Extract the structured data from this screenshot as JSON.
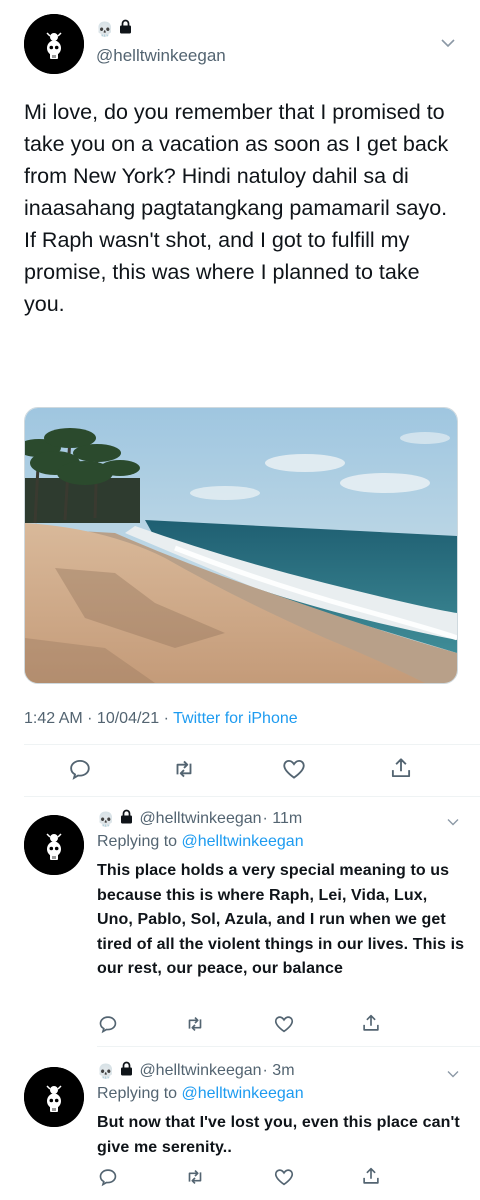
{
  "main_tweet": {
    "handle": "@helltwinkeegan",
    "text": "Mi love, do you remember that I promised to take you on a vacation as soon as I get back from New York? Hindi natuloy dahil sa di inaasahang pagtatangkang pamamaril sayo. If Raph wasn't shot, and I got to fulfill my promise, this was where I planned to take you.",
    "time": "1:42 AM · 10/04/21 · ",
    "source": "Twitter for iPhone"
  },
  "replies": [
    {
      "handle": "@helltwinkeegan",
      "age": "· 11m",
      "replying_label": "Replying to ",
      "replying_handle": "@helltwinkeegan",
      "text": "This place holds a very special meaning to us because this is where Raph, Lei, Vida, Lux, Uno, Pablo, Sol, Azula, and I run when we get tired of all the violent things in our lives. This is our rest, our peace, our balance"
    },
    {
      "handle": "@helltwinkeegan",
      "age": "· 3m",
      "replying_label": "Replying to ",
      "replying_handle": "@helltwinkeegan",
      "text": "But now that I've lost you, even this place can't give me serenity.."
    }
  ],
  "emoji": {
    "skull": "💀"
  },
  "icons": [
    "skull-icon",
    "lock-icon",
    "chevron-down-icon",
    "reply-icon",
    "retweet-icon",
    "like-icon",
    "share-icon"
  ],
  "colors": {
    "accent": "#1d9bf0",
    "muted": "#536471",
    "text": "#0f1419"
  }
}
